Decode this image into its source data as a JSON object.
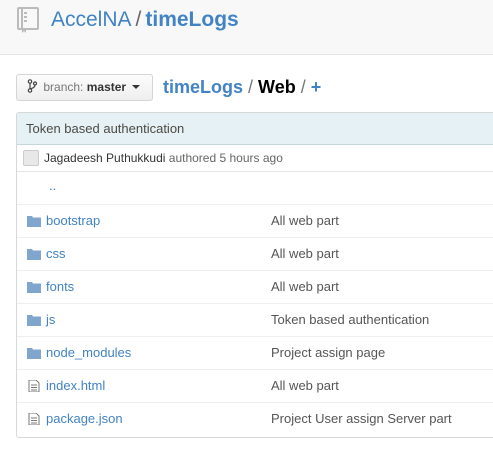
{
  "header": {
    "owner": "AccelNA",
    "separator": "/",
    "repo": "timeLogs"
  },
  "branch": {
    "label": "branch:",
    "value": "master"
  },
  "breadcrumb": {
    "root": "timeLogs",
    "separator1": "/",
    "current": "Web",
    "separator2": "/",
    "add": "+"
  },
  "latest_commit": {
    "message": "Token based authentication",
    "author": "Jagadeesh Puthukkudi",
    "authored_text": "authored 5 hours ago"
  },
  "files": {
    "parent": "..",
    "items": [
      {
        "name": "bootstrap",
        "type": "folder",
        "message": "All web part"
      },
      {
        "name": "css",
        "type": "folder",
        "message": "All web part"
      },
      {
        "name": "fonts",
        "type": "folder",
        "message": "All web part"
      },
      {
        "name": "js",
        "type": "folder",
        "message": "Token based authentication"
      },
      {
        "name": "node_modules",
        "type": "folder",
        "message": "Project assign page"
      },
      {
        "name": "index.html",
        "type": "file",
        "message": "All web part"
      },
      {
        "name": "package.json",
        "type": "file",
        "message": "Project User assign Server part"
      }
    ]
  },
  "colors": {
    "link": "#4183c4",
    "folder_icon": "#80a6cd",
    "commit_bar": "#e6f1f6"
  },
  "icons": {
    "repo": "repo-book-icon",
    "branch": "git-branch-icon",
    "folder": "folder-icon",
    "file": "file-text-icon"
  }
}
